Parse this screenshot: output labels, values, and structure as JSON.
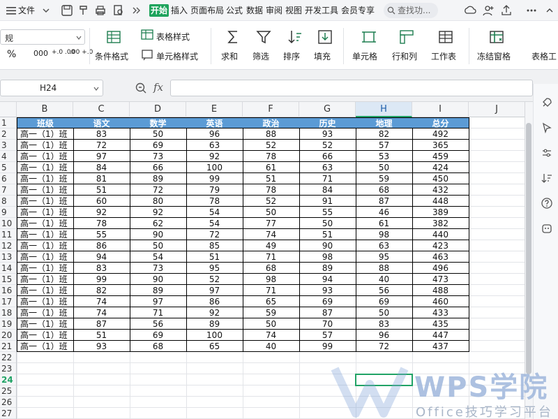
{
  "menubar": {
    "items": [
      "文件",
      "开始",
      "插入",
      "页面布局",
      "公式",
      "数据",
      "审阅",
      "视图",
      "开发工具",
      "会员专享"
    ],
    "search_placeholder": "查找功..."
  },
  "ribbon": {
    "font_box": "规",
    "percent": "%",
    "thousands": "000",
    "inc_decimal": "+.0 .00",
    "dec_decimal": ".00 +.0",
    "cond_format": "条件格式",
    "table_style": "表格样式",
    "cell_style": "单元格样式",
    "sum": "求和",
    "filter": "筛选",
    "sort": "排序",
    "fill": "填充",
    "cell": "单元格",
    "row_col": "行和列",
    "worksheet": "工作表",
    "freeze": "冻结窗格",
    "table_tools": "表格工"
  },
  "formula_bar": {
    "name_box": "H24",
    "fx_label": "fx",
    "formula": ""
  },
  "sheet": {
    "columns": [
      "B",
      "C",
      "D",
      "E",
      "F",
      "G",
      "H",
      "I",
      "J"
    ],
    "selected_column": "H",
    "rows": [
      "1",
      "2",
      "3",
      "4",
      "5",
      "6",
      "7",
      "8",
      "9",
      "10",
      "11",
      "12",
      "13",
      "14",
      "15",
      "16",
      "17",
      "18",
      "19",
      "20",
      "21",
      "22",
      "23",
      "24",
      "25",
      "26",
      "27"
    ],
    "selected_row": "24",
    "selected_cell": "H24",
    "header_color": "#5b9bd5",
    "selection_color": "#21a366",
    "table_header": [
      "班级",
      "语文",
      "数学",
      "英语",
      "政治",
      "历史",
      "地理",
      "总分"
    ],
    "table_rows": [
      [
        "高一（1）班",
        "83",
        "50",
        "96",
        "88",
        "93",
        "82",
        "492"
      ],
      [
        "高一（1）班",
        "72",
        "69",
        "63",
        "52",
        "52",
        "57",
        "365"
      ],
      [
        "高一（1）班",
        "97",
        "73",
        "92",
        "78",
        "66",
        "53",
        "459"
      ],
      [
        "高一（1）班",
        "84",
        "66",
        "100",
        "61",
        "63",
        "50",
        "424"
      ],
      [
        "高一（1）班",
        "81",
        "89",
        "99",
        "51",
        "71",
        "59",
        "450"
      ],
      [
        "高一（1）班",
        "51",
        "72",
        "79",
        "78",
        "84",
        "68",
        "432"
      ],
      [
        "高一（1）班",
        "60",
        "80",
        "78",
        "52",
        "91",
        "87",
        "448"
      ],
      [
        "高一（1）班",
        "92",
        "92",
        "54",
        "50",
        "55",
        "46",
        "389"
      ],
      [
        "高一（1）班",
        "78",
        "62",
        "54",
        "77",
        "50",
        "61",
        "382"
      ],
      [
        "高一（1）班",
        "55",
        "90",
        "72",
        "74",
        "51",
        "98",
        "440"
      ],
      [
        "高一（1）班",
        "86",
        "50",
        "85",
        "49",
        "90",
        "63",
        "423"
      ],
      [
        "高一（1）班",
        "94",
        "54",
        "51",
        "71",
        "98",
        "95",
        "463"
      ],
      [
        "高一（1）班",
        "83",
        "73",
        "95",
        "68",
        "89",
        "88",
        "496"
      ],
      [
        "高一（1）班",
        "99",
        "90",
        "52",
        "98",
        "94",
        "40",
        "473"
      ],
      [
        "高一（1）班",
        "82",
        "89",
        "97",
        "71",
        "93",
        "56",
        "488"
      ],
      [
        "高一（1）班",
        "74",
        "97",
        "86",
        "65",
        "69",
        "69",
        "460"
      ],
      [
        "高一（1）班",
        "74",
        "71",
        "92",
        "59",
        "87",
        "50",
        "433"
      ],
      [
        "高一（1）班",
        "87",
        "56",
        "89",
        "50",
        "70",
        "83",
        "435"
      ],
      [
        "高一（1）班",
        "51",
        "69",
        "100",
        "74",
        "57",
        "96",
        "447"
      ],
      [
        "高一（1）班",
        "93",
        "68",
        "65",
        "40",
        "99",
        "72",
        "437"
      ]
    ]
  },
  "watermark": {
    "brand": "WPS学院",
    "subtitle": "Office技巧学习平台"
  }
}
